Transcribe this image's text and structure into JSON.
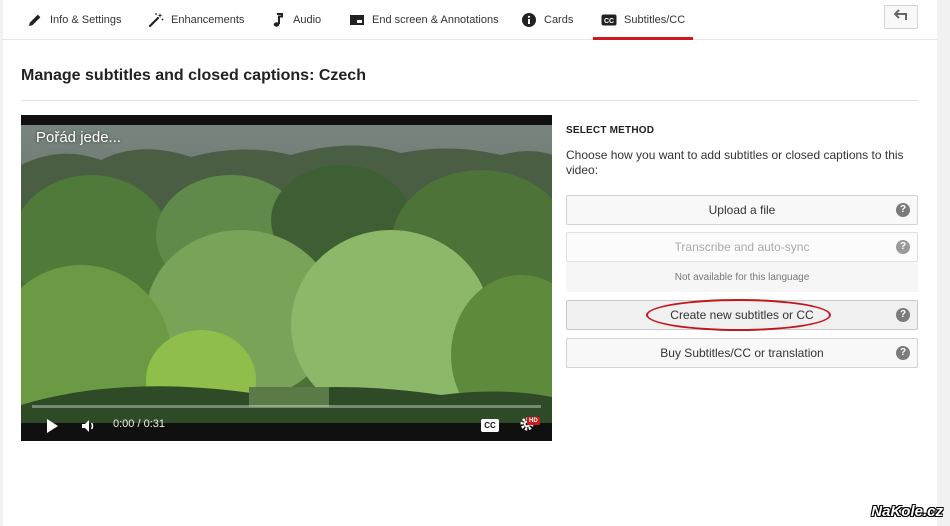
{
  "tabs": [
    {
      "label": "Info & Settings",
      "icon": "pencil-icon"
    },
    {
      "label": "Enhancements",
      "icon": "magic-wand-icon"
    },
    {
      "label": "Audio",
      "icon": "music-note-icon"
    },
    {
      "label": "End screen & Annotations",
      "icon": "end-screen-icon"
    },
    {
      "label": "Cards",
      "icon": "info-icon"
    },
    {
      "label": "Subtitles/CC",
      "icon": "cc-icon",
      "active": true
    }
  ],
  "header": {
    "back_icon": "back-arrow-icon"
  },
  "page": {
    "title": "Manage subtitles and closed captions: Czech"
  },
  "video": {
    "title": "Pořád jede...",
    "time": "0:00 / 0:31",
    "progress": 0,
    "cc_label": "CC",
    "hd_badge": "HD"
  },
  "method": {
    "heading": "SELECT METHOD",
    "description": "Choose how you want to add subtitles or closed captions to this video:",
    "options": [
      {
        "label": "Upload a file",
        "enabled": true
      },
      {
        "label": "Transcribe and auto-sync",
        "enabled": false
      },
      {
        "label": "Create new subtitles or CC",
        "enabled": true
      },
      {
        "label": "Buy Subtitles/CC or translation",
        "enabled": true
      }
    ],
    "unavailable_note": "Not available for this language",
    "help_glyph": "?"
  },
  "watermark": "NaKole.cz",
  "colors": {
    "accent": "#cc181e"
  }
}
